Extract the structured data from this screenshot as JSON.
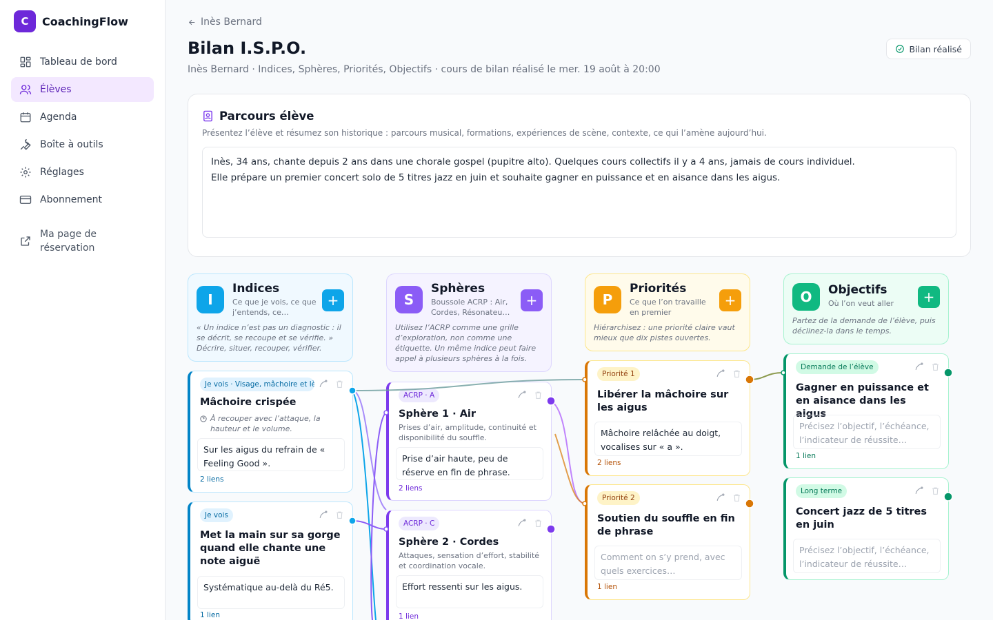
{
  "app": {
    "logo_letter": "C",
    "name": "CoachingFlow"
  },
  "nav": [
    {
      "label": "Tableau de bord",
      "icon": "dashboard-icon"
    },
    {
      "label": "Élèves",
      "icon": "users-icon",
      "active": true
    },
    {
      "label": "Agenda",
      "icon": "calendar-icon"
    },
    {
      "label": "Boîte à outils",
      "icon": "wrench-icon"
    },
    {
      "label": "Réglages",
      "icon": "gear-icon"
    },
    {
      "label": "Abonnement",
      "icon": "credit-card-icon"
    }
  ],
  "booking_link": {
    "label": "Ma page de\nréservation",
    "icon": "external-link-icon"
  },
  "header": {
    "back_label": "Inès Bernard",
    "title": "Bilan I.S.P.O.",
    "subtitle": "Inès Bernard · Indices, Sphères, Priorités, Objectifs · cours de bilan réalisé le mer. 19 août à 20:00",
    "status_label": "Bilan réalisé"
  },
  "parcours": {
    "title": "Parcours élève",
    "description": "Présentez l’élève et résumez son historique : parcours musical, formations, expériences de scène, contexte, ce qui l’amène aujourd’hui.",
    "text": "Inès, 34 ans, chante depuis 2 ans dans une chorale gospel (pupitre alto). Quelques cours collectifs il y a 4 ans, jamais de cours individuel.\nElle prépare un premier concert solo de 5 titres jazz en juin et souhaite gagner en puissance et en aisance dans les aigus."
  },
  "columns": {
    "indices": {
      "letter": "I",
      "title": "Indices",
      "subtitle": "Ce que je vois, ce que j’entends, ce…",
      "note": "« Un indice n’est pas un diagnostic : il se décrit, se recoupe et se vérifie. » Décrire, situer, recouper, vérifier.",
      "color": "#0ea5e9"
    },
    "spheres": {
      "letter": "S",
      "title": "Sphères",
      "subtitle": "Boussole ACRP : Air, Cordes, Résonateu…",
      "note": "Utilisez l’ACRP comme une grille d’exploration, non comme une étiquette. Un même indice peut faire appel à plusieurs sphères à la fois.",
      "color": "#8b5cf6"
    },
    "priorites": {
      "letter": "P",
      "title": "Priorités",
      "subtitle": "Ce que l’on travaille en premier",
      "note": "Hiérarchisez : une priorité claire vaut mieux que dix pistes ouvertes.",
      "color": "#f59e0b"
    },
    "objectifs": {
      "letter": "O",
      "title": "Objectifs",
      "subtitle": "Où l’on veut aller",
      "note": "Partez de la demande de l’élève, puis déclinez-la dans le temps.",
      "color": "#10b981"
    }
  },
  "cards": {
    "indice1": {
      "badge": "Je vois · Visage, mâchoire et lèvres",
      "title": "Mâchoire crispée",
      "hint": "À recouper avec l’attaque, la hauteur et le volume.",
      "text": "Sur les aigus du refrain de « Feeling Good ».",
      "links": "2 liens"
    },
    "indice2": {
      "badge": "Je vois",
      "title": "Met la main sur sa gorge quand elle chante une note aiguë",
      "text": "Systématique au-delà du Ré5.",
      "links": "1 lien"
    },
    "sphere1": {
      "badge": "ACRP · A",
      "title": "Sphère 1 · Air",
      "hint": "Prises d’air, amplitude, continuité et disponibilité du souffle.",
      "text": "Prise d’air haute, peu de réserve en fin de phrase.",
      "links": "2 liens"
    },
    "sphere2": {
      "badge": "ACRP · C",
      "title": "Sphère 2 · Cordes",
      "hint": "Attaques, sensation d’effort, stabilité et coordination vocale.",
      "text": "Effort ressenti sur les aigus.",
      "links": "1 lien"
    },
    "prio1": {
      "badge": "Priorité 1",
      "title": "Libérer la mâchoire sur les aigus",
      "text": "Mâchoire relâchée au doigt, vocalises sur « a ».",
      "links": "2 liens"
    },
    "prio2": {
      "badge": "Priorité 2",
      "title": "Soutien du souffle en fin de phrase",
      "placeholder": "Comment on s’y prend, avec quels exercices…",
      "links": "1 lien"
    },
    "obj1": {
      "badge": "Demande de l’élève",
      "title": "Gagner en puissance et en aisance dans les aigus",
      "placeholder": "Précisez l’objectif, l’échéance, l’indicateur de réussite…",
      "links": "1 lien"
    },
    "obj2": {
      "badge": "Long terme",
      "title": "Concert jazz de 5 titres en juin",
      "placeholder": "Précisez l’objectif, l’échéance, l’indicateur de réussite…"
    }
  }
}
